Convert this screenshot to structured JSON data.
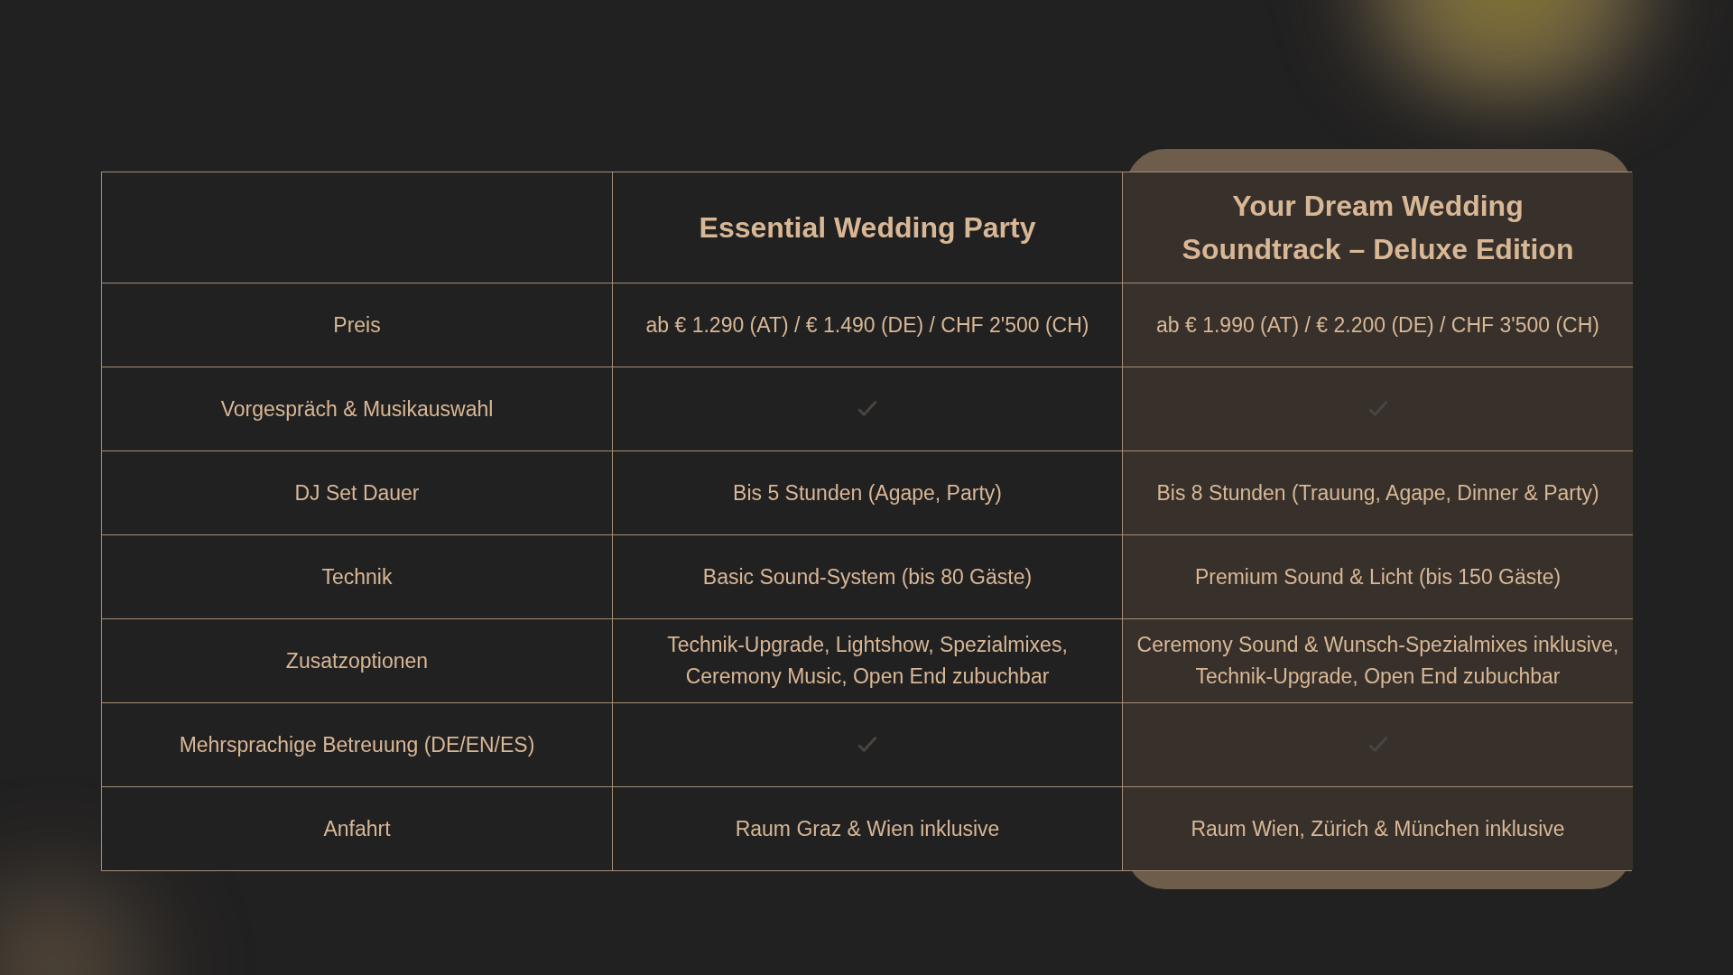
{
  "table": {
    "columns": [
      {
        "label": "Essential Wedding Party",
        "highlighted": false
      },
      {
        "label": "Your Dream Wedding Soundtrack – Deluxe Edition",
        "highlighted": true
      }
    ],
    "rows": [
      {
        "label": "Preis",
        "cells": [
          {
            "kind": "text",
            "text": "ab € 1.290 (AT) / € 1.490 (DE) / CHF 2'500 (CH)"
          },
          {
            "kind": "text",
            "text": "ab € 1.990 (AT) / € 2.200 (DE) / CHF 3'500 (CH)"
          }
        ]
      },
      {
        "label": "Vorgespräch & Musikauswahl",
        "cells": [
          {
            "kind": "check",
            "checked": true
          },
          {
            "kind": "check",
            "checked": true
          }
        ]
      },
      {
        "label": "DJ Set Dauer",
        "cells": [
          {
            "kind": "text",
            "text": "Bis 5 Stunden (Agape, Party)"
          },
          {
            "kind": "text",
            "text": "Bis 8 Stunden (Trauung, Agape, Dinner & Party)"
          }
        ]
      },
      {
        "label": "Technik",
        "cells": [
          {
            "kind": "text",
            "text": "Basic Sound-System (bis 80 Gäste)"
          },
          {
            "kind": "text",
            "text": "Premium Sound & Licht (bis 150 Gäste)"
          }
        ]
      },
      {
        "label": "Zusatzoptionen",
        "cells": [
          {
            "kind": "text",
            "text": "Technik-Upgrade, Lightshow, Spezialmixes, Ceremony Music, Open End zubuchbar"
          },
          {
            "kind": "text",
            "text": "Ceremony Sound & Wunsch-Spezialmixes inklusive, Technik-Upgrade, Open End zubuchbar"
          }
        ]
      },
      {
        "label": "Mehrsprachige Betreuung (DE/EN/ES)",
        "cells": [
          {
            "kind": "check",
            "checked": true
          },
          {
            "kind": "check",
            "checked": true
          }
        ]
      },
      {
        "label": "Anfahrt",
        "cells": [
          {
            "kind": "text",
            "text": "Raum Graz & Wien inklusive"
          },
          {
            "kind": "text",
            "text": "Raum Wien, Zürich & München inklusive"
          }
        ]
      }
    ]
  }
}
